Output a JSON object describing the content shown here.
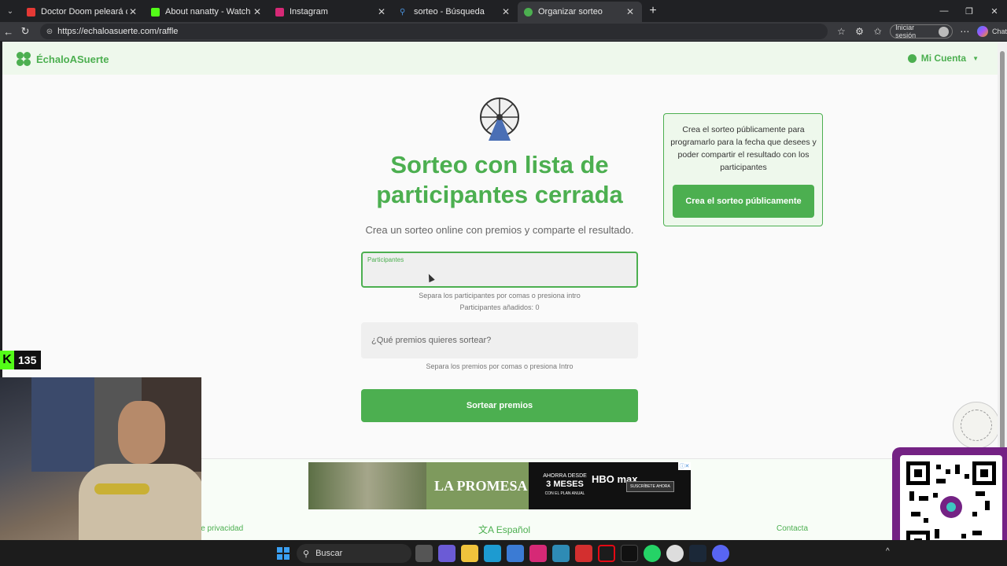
{
  "browser": {
    "tabs": [
      {
        "title": "Doctor Doom peleará con Magneto",
        "color": "#e53935"
      },
      {
        "title": "About nanatty - Watch Live on Kick",
        "color": "#53fc18"
      },
      {
        "title": "Instagram",
        "color": "#d62976"
      },
      {
        "title": "sorteo - Búsqueda",
        "color": "#4a90d9"
      },
      {
        "title": "Organizar sorteo",
        "color": "#4caf50",
        "active": true
      }
    ],
    "url": "https://echaloasuerte.com/raffle",
    "signin_label": "Iniciar sesión",
    "chat_label": "Chat"
  },
  "site": {
    "brand": "ÉchaloASuerte",
    "account": "Mi Cuenta",
    "accent": "#4caf50"
  },
  "main": {
    "title": "Sorteo con lista de participantes cerrada",
    "subtitle": "Crea un sorteo online con premios y comparte el resultado.",
    "participants_label": "Participantes",
    "participants_value": "",
    "participants_help": "Separa los participantes por comas o presiona intro",
    "participants_count": "Participantes añadidos: 0",
    "prizes_placeholder": "¿Qué premios quieres sortear?",
    "prizes_help": "Separa los premios por comas o presiona Intro",
    "draw_button": "Sortear premios"
  },
  "side_card": {
    "text": "Crea el sorteo públicamente para programarlo para la fecha que desees y poder compartir el resultado con los participantes",
    "button": "Crea el sorteo públicamente"
  },
  "ad": {
    "brand_text": "LA PROMESA",
    "offer_top": "AHORRA DESDE",
    "offer_main": "3 MESES",
    "offer_bottom": "CON EL PLAN ANUAL",
    "service": "HBO max",
    "cta": "SUSCRÍBETE AHORA"
  },
  "footer": {
    "privacy": "le privacidad",
    "language": "Español",
    "contact": "Contacta"
  },
  "overlay": {
    "kick_count": "135"
  },
  "taskbar": {
    "search_label": "Buscar"
  }
}
